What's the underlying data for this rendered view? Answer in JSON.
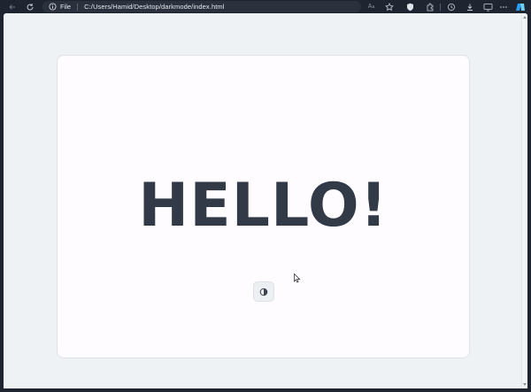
{
  "browser": {
    "file_label": "File",
    "url": "C:/Users/Hamid/Desktop/darkmode/index.html",
    "read_aloud_glyph": "A",
    "read_aloud_superscript": "a"
  },
  "page": {
    "heading": "HELLO!",
    "theme_toggle_icon": "half-circle-contrast-icon"
  },
  "colors": {
    "browser_chrome": "#1f2431",
    "page_background": "#eef2f5",
    "card_background": "#fefcfe",
    "heading_color": "#333a47"
  }
}
